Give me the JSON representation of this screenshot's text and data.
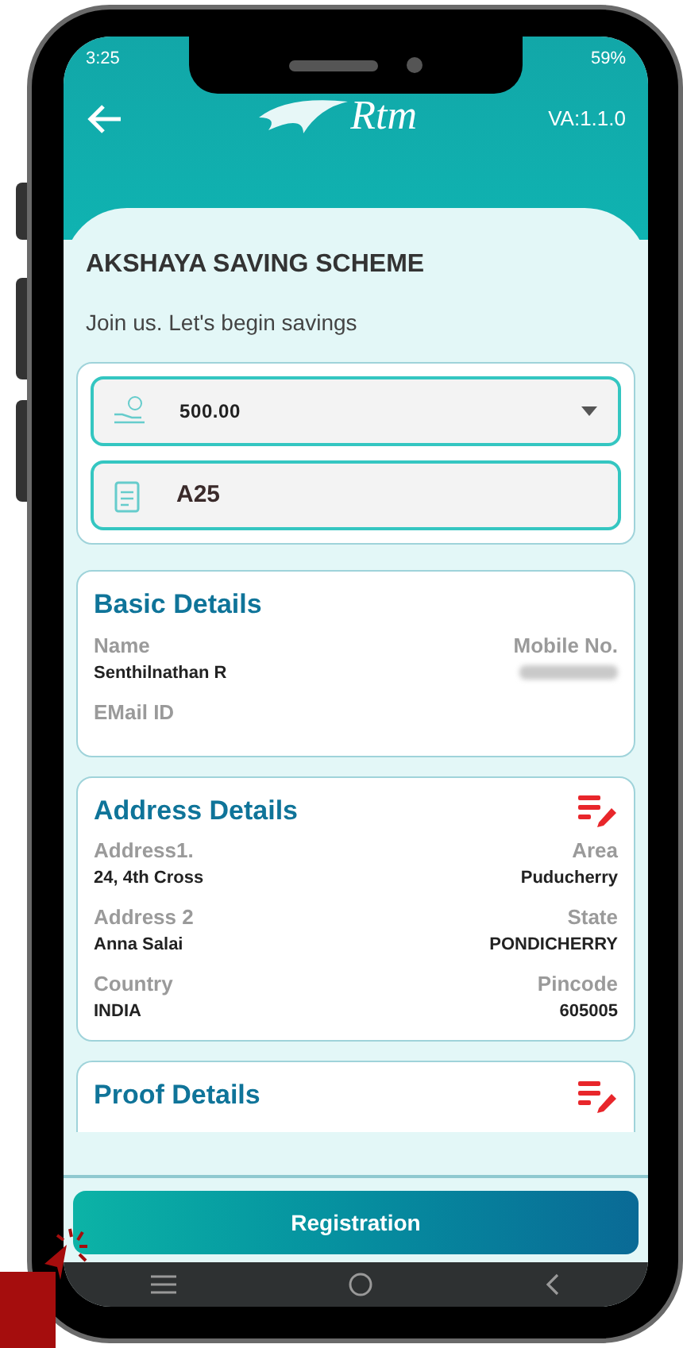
{
  "status_bar": {
    "time": "3:25",
    "battery": "59%"
  },
  "header": {
    "logo": "Rtm",
    "version": "VA:1.1.0"
  },
  "title": "AKSHAYA SAVING SCHEME",
  "subtitle": "Join us. Let's begin savings",
  "amount_field": {
    "value": "500.00"
  },
  "code_field": {
    "value": "A25"
  },
  "sections": [
    {
      "title": "Basic Details",
      "editable": false,
      "rows": [
        {
          "left": {
            "label": "Name",
            "value": "Senthilnathan R"
          },
          "right": {
            "label": "Mobile No.",
            "redacted": true
          }
        },
        {
          "left": {
            "label": "EMail ID"
          }
        }
      ]
    },
    {
      "title": "Address Details",
      "editable": true,
      "rows": [
        {
          "left": {
            "label": "Address1.",
            "value": "24, 4th Cross"
          },
          "right": {
            "label": "Area",
            "value": "Puducherry"
          }
        },
        {
          "left": {
            "label": "Address 2",
            "value": "Anna Salai"
          },
          "right": {
            "label": "State",
            "value": "PONDICHERRY"
          }
        },
        {
          "left": {
            "label": "Country",
            "value": "INDIA"
          },
          "right": {
            "label": "Pincode",
            "value": "605005"
          }
        }
      ]
    },
    {
      "title": "Proof Details",
      "editable": true
    }
  ],
  "register_button": "Registration"
}
